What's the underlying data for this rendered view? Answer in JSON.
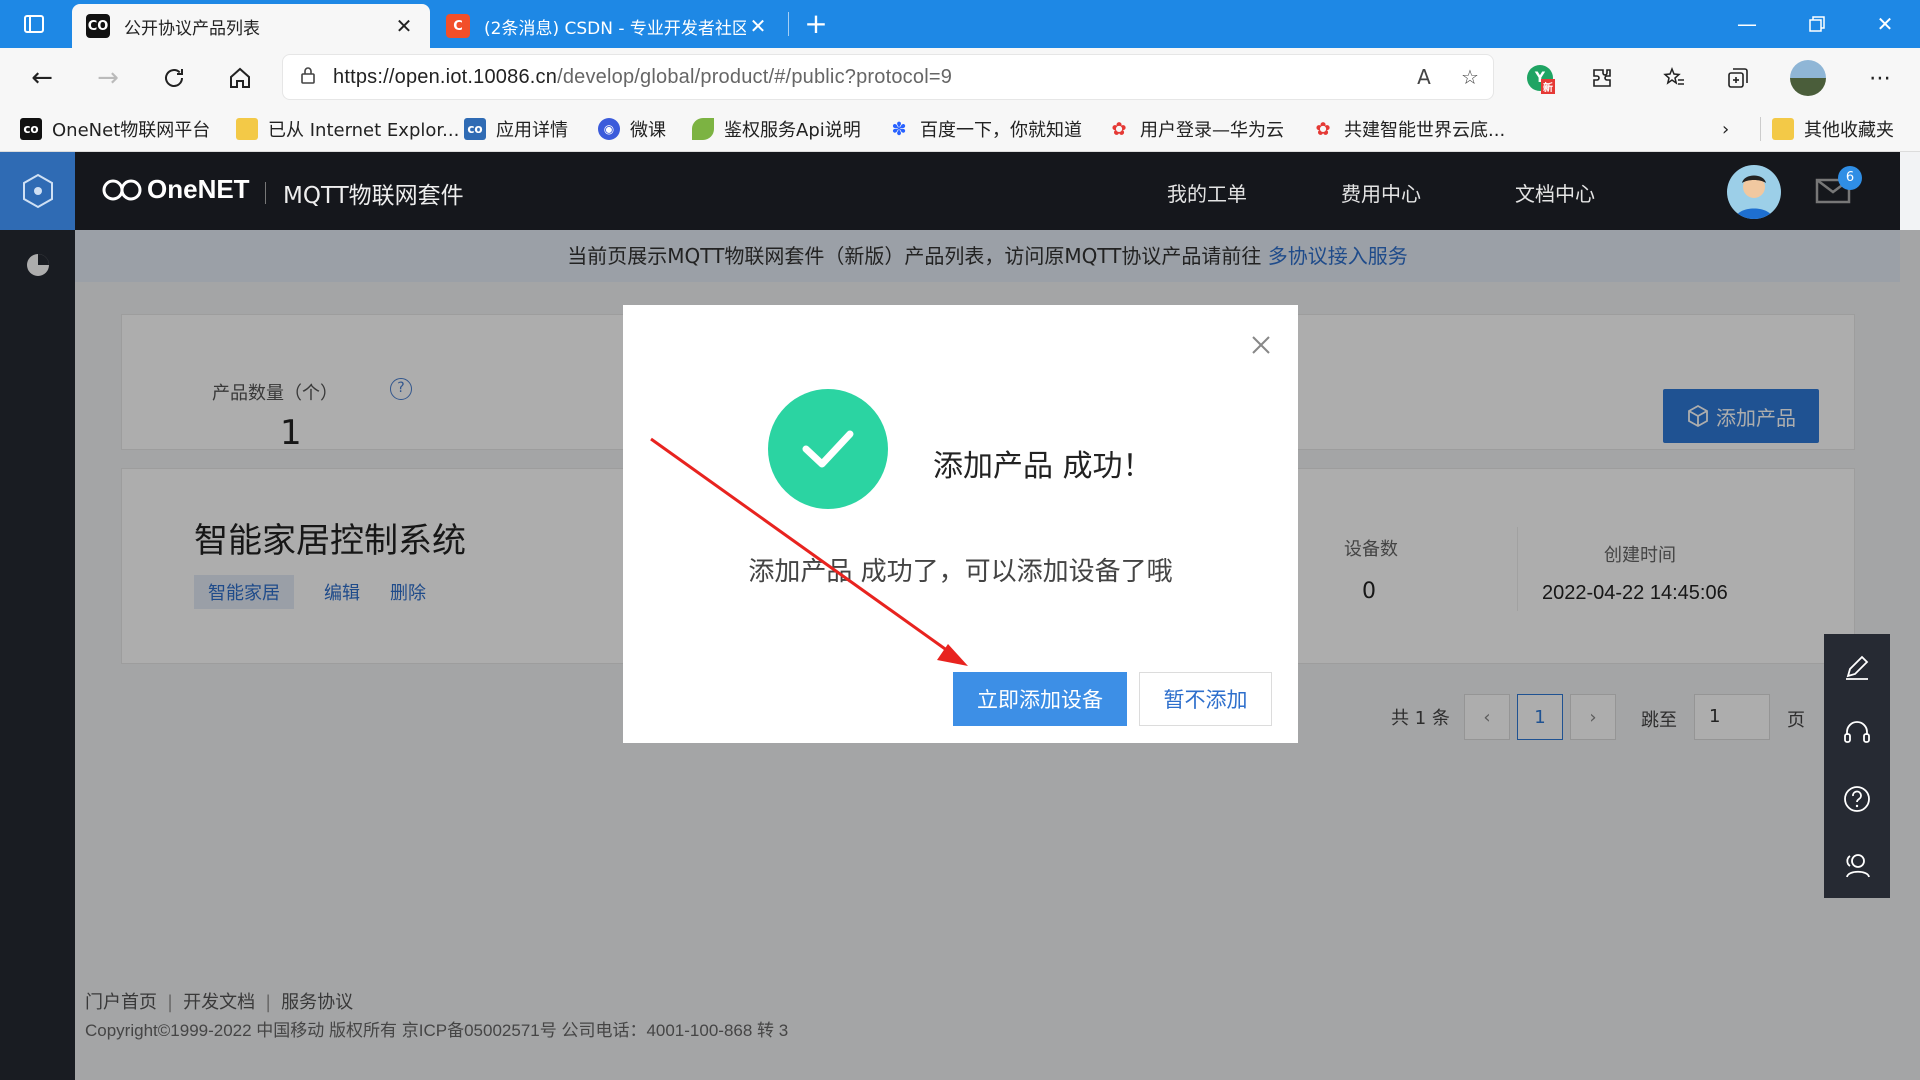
{
  "browser": {
    "tabs": [
      {
        "title": "公开协议产品列表",
        "active": true
      },
      {
        "title": "(2条消息) CSDN - 专业开发者社区",
        "active": false
      }
    ],
    "url_host": "https://open.iot.10086.cn",
    "url_path": "/develop/global/product/#/public?protocol=9",
    "bookmarks": [
      "OneNet物联网平台",
      "已从 Internet Explor...",
      "应用详情",
      "微课",
      "鉴权服务Api说明",
      "百度一下，你就知道",
      "用户登录—华为云",
      "共建智能世界云底...",
      "其他收藏夹"
    ],
    "ext_badge": "新"
  },
  "header": {
    "logo": "OneNET",
    "suite": "MQTT物联网套件",
    "nav": [
      "我的工单",
      "费用中心",
      "文档中心"
    ],
    "mail_count": "6"
  },
  "notice": {
    "text": "当前页展示MQTT物联网套件（新版）产品列表，访问原MQTT协议产品请前往",
    "link": "多协议接入服务"
  },
  "stats": {
    "label": "产品数量（个）",
    "help": "?",
    "value": "1",
    "add_button": "添加产品"
  },
  "product": {
    "name": "智能家居控制系统",
    "tag": "智能家居",
    "edit": "编辑",
    "delete": "删除",
    "device_label": "设备数",
    "device_value": "0",
    "created_label": "创建时间",
    "created_value": "2022-04-22 14:45:06"
  },
  "pagination": {
    "total": "共 1 条",
    "current": "1",
    "jump_label": "跳至",
    "jump_value": "1",
    "page_unit": "页"
  },
  "footer": {
    "links": [
      "门户首页",
      "开发文档",
      "服务协议"
    ],
    "copyright": "Copyright©1999-2022 中国移动 版权所有 京ICP备05002571号 公司电话：4001-100-868 转 3"
  },
  "modal": {
    "title": "添加产品 成功！",
    "message": "添加产品 成功了，可以添加设备了哦",
    "primary": "立即添加设备",
    "secondary": "暂不添加"
  },
  "colors": {
    "browser_accent": "#1e88e5",
    "header_bg": "#15171c",
    "primary_blue": "#2f7ad8",
    "success_green": "#2bd4a2",
    "arrow_red": "#e8231f"
  }
}
